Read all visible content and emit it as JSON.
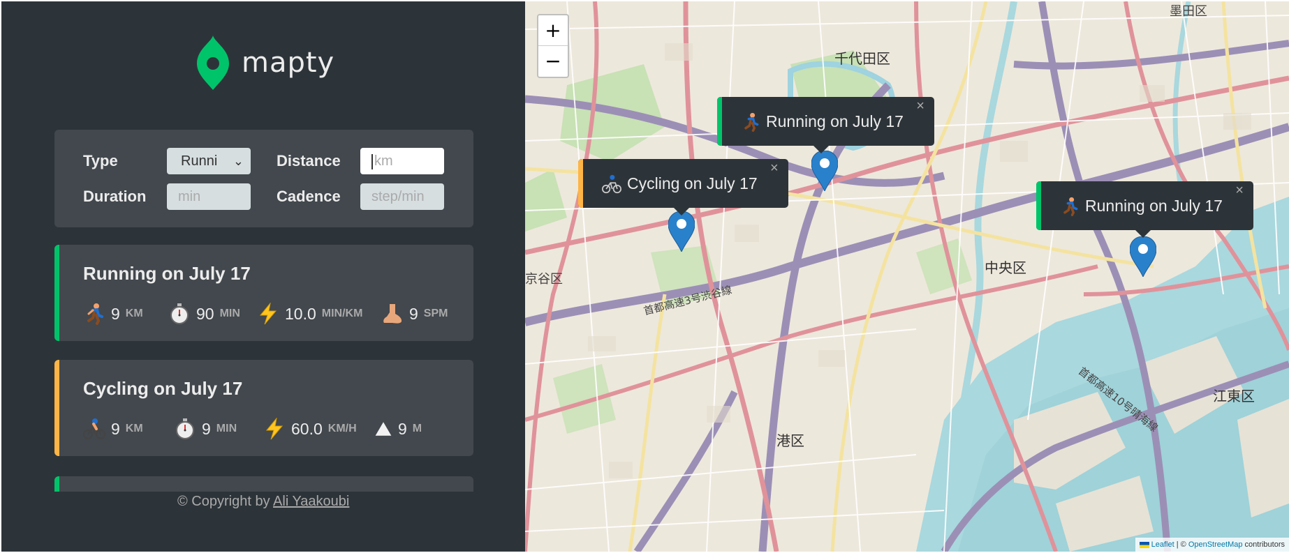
{
  "app": {
    "logo_text": "mapty"
  },
  "form": {
    "type_label": "Type",
    "type_value": "Runni",
    "distance_label": "Distance",
    "distance_placeholder": "km",
    "duration_label": "Duration",
    "duration_placeholder": "min",
    "cadence_label": "Cadence",
    "cadence_placeholder": "step/min"
  },
  "workouts": [
    {
      "type": "running",
      "title": "Running on July 17",
      "color": "#00c46a",
      "stats": [
        {
          "icon": "running-icon",
          "value": "9",
          "unit": "KM"
        },
        {
          "icon": "stopwatch-icon",
          "value": "90",
          "unit": "MIN"
        },
        {
          "icon": "lightning-icon",
          "value": "10.0",
          "unit": "MIN/KM"
        },
        {
          "icon": "foot-icon",
          "value": "9",
          "unit": "SPM"
        }
      ]
    },
    {
      "type": "cycling",
      "title": "Cycling on July 17",
      "color": "#ffb545",
      "stats": [
        {
          "icon": "cycling-icon",
          "value": "9",
          "unit": "KM"
        },
        {
          "icon": "stopwatch-icon",
          "value": "9",
          "unit": "MIN"
        },
        {
          "icon": "lightning-icon",
          "value": "60.0",
          "unit": "KM/H"
        },
        {
          "icon": "mountain-icon",
          "value": "9",
          "unit": "M"
        }
      ]
    }
  ],
  "footer": {
    "copyright_prefix": "© Copyright by",
    "author": "Ali Yaakoubi"
  },
  "map": {
    "zoom_in": "+",
    "zoom_out": "−",
    "popups": [
      {
        "title": "Running on July 17",
        "color": "#00c46a",
        "icon": "running-icon"
      },
      {
        "title": "Cycling on July 17",
        "color": "#ffb545",
        "icon": "cycling-icon"
      },
      {
        "title": "Running on July 17",
        "color": "#00c46a",
        "icon": "running-icon"
      }
    ],
    "close_glyph": "×",
    "labels": [
      "千代田区",
      "中央区",
      "港区",
      "江東区",
      "京谷区",
      "墨田区",
      "首都高速3号渋谷線",
      "首都高速10号晴海線"
    ],
    "attribution": {
      "leaflet": "Leaflet",
      "sep": " | © ",
      "osm": "OpenStreetMap",
      "suffix": " contributors"
    }
  }
}
